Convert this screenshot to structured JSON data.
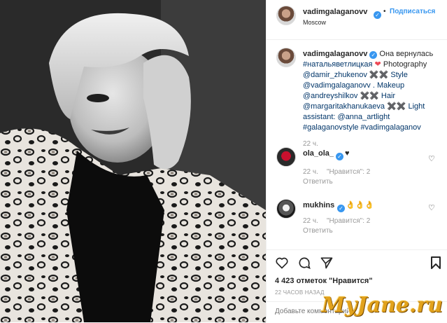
{
  "header": {
    "username": "vadimgalaganovv",
    "follow_label": "Подписаться",
    "separator": "•",
    "location": "Moscow"
  },
  "caption": {
    "username": "vadimgalaganovv",
    "lines": [
      "Она вернулась",
      "#натальяветлицкая",
      "Photography",
      "@damir_zhukenov ✖️✖️ Style",
      "@vadimgalaganovv . Makeup",
      "@andreyshilkov ✖️✖️ Hair",
      "@margaritakhanukaeva ✖️✖️ Light",
      "assistant: @anna_artlight",
      "#galaganovstyle #vadimgalaganov"
    ],
    "heart": "❤",
    "time": "22 ч."
  },
  "comments": [
    {
      "username": "ola_ola_",
      "text": "♥",
      "time": "22 ч.",
      "likes": "\"Нравится\": 2",
      "reply": "Ответить"
    },
    {
      "username": "mukhins",
      "text": "👌👌👌",
      "time": "22 ч.",
      "likes": "\"Нравится\": 2",
      "reply": "Ответить"
    }
  ],
  "actions": {
    "like_icon": "heart-outline-icon",
    "comment_icon": "comment-bubble-icon",
    "share_icon": "share-plane-icon",
    "save_icon": "bookmark-icon",
    "likes_text": "4 423 отметок \"Нравится\"",
    "timestamp": "22 ЧАСОВ НАЗАД"
  },
  "footer": {
    "placeholder": "Добавьте комментарий..."
  },
  "watermark": "MyJane.ru",
  "colors": {
    "accent": "#3897f0",
    "heart": "#ed4956",
    "watermark": "#e2a21c"
  }
}
